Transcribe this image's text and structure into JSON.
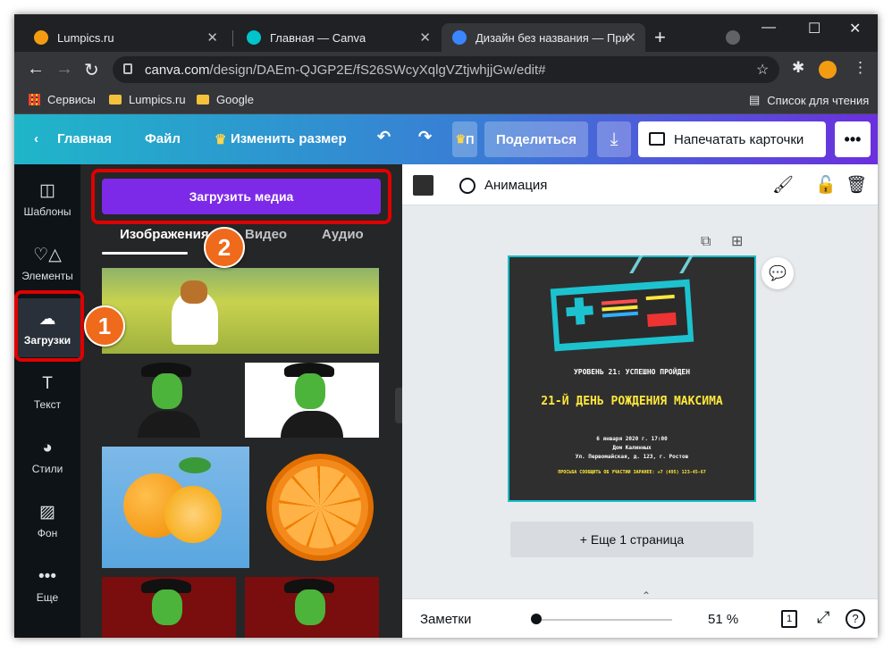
{
  "tabs": [
    {
      "title": "Lumpics.ru"
    },
    {
      "title": "Главная — Canva"
    },
    {
      "title": "Дизайн без названия — Пригл"
    }
  ],
  "url": {
    "domain": "canva.com",
    "path": "/design/DAEm-QJGP2E/fS26SWcyXqlgVZtjwhjjGw/edit#"
  },
  "bookmarks": {
    "services": "Сервисы",
    "lumpics": "Lumpics.ru",
    "google": "Google",
    "reading_list": "Список для чтения"
  },
  "canva_header": {
    "home": "Главная",
    "file": "Файл",
    "resize": "Изменить размер",
    "truncated": "П",
    "share": "Поделиться",
    "print": "Напечатать карточки",
    "more": "•••"
  },
  "rail": [
    {
      "label": "Шаблоны",
      "icon": "templates-icon"
    },
    {
      "label": "Элементы",
      "icon": "elements-icon"
    },
    {
      "label": "Загрузки",
      "icon": "upload-icon"
    },
    {
      "label": "Текст",
      "icon": "text-icon"
    },
    {
      "label": "Стили",
      "icon": "palette-icon"
    },
    {
      "label": "Фон",
      "icon": "background-icon"
    },
    {
      "label": "Еще",
      "icon": "more-icon"
    }
  ],
  "panel": {
    "upload_button": "Загрузить медиа",
    "tabs": [
      "Изображения",
      "Видео",
      "Аудио"
    ]
  },
  "editor": {
    "animation": "Анимация",
    "add_page": "+ Еще 1 страница",
    "notes": "Заметки",
    "zoom": "51 %",
    "page_count": "1",
    "zoom_value": 0.05
  },
  "card": {
    "level": "УРОВЕНЬ 21: УСПЕШНО ПРОЙДЕН",
    "title": "21-Й ДЕНЬ РОЖДЕНИЯ МАКСИМА",
    "line1": "6 января 2020 г. 17:00",
    "line2": "Дом Калинных",
    "line3": "Ул. Первомайская, д. 123, г. Ростов",
    "rsvp": "ПРОСЬБА СООБЩИТЬ ОБ УЧАСТИИ ЗАРАНЕЕ: +7 (495) 123-45-67"
  },
  "annotations": {
    "badge1": "1",
    "badge2": "2"
  },
  "colors": {
    "canva_purple": "#7d2ae8",
    "highlight_red": "#e00000",
    "badge_orange": "#ef6a1b",
    "card_bg": "#2f2f2f",
    "card_title": "#ffe83a"
  }
}
